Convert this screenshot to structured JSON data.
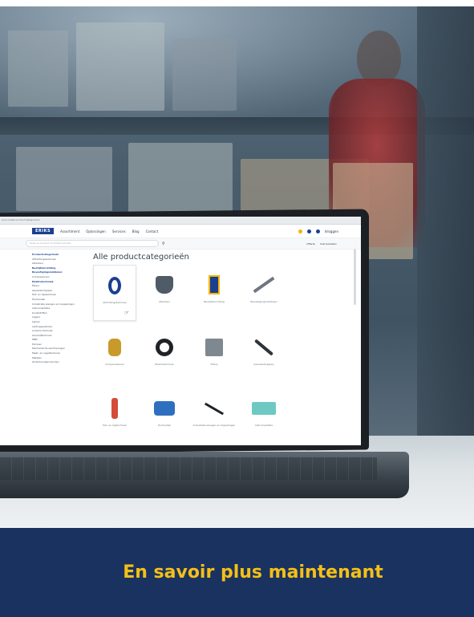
{
  "browser": {
    "url": "erics.nl/alle-productcategorieen"
  },
  "nav": {
    "logo": "ERIKS",
    "items": [
      "Assortiment",
      "Oplossingen",
      "Services",
      "Blog",
      "Contact"
    ],
    "login": "Inloggen"
  },
  "search": {
    "placeholder": "Zoek op product of artikelnummer",
    "links": [
      "Offerte",
      "Snel bestellen"
    ]
  },
  "sidebar": {
    "items": [
      "Productcategorieën",
      "Afdichtingstechniek",
      "Afsluiters",
      "Bedrijfsinrichting",
      "Bevestigingsmiddelen",
      "Compressoren",
      "Elektrotechniek",
      "Filters",
      "Gereedschappen",
      "Hef- en hijstechniek",
      "Hydrauliek",
      "Industriële slangen en koppelingen",
      "Instrumentatie",
      "Kunststoffen",
      "Lagers",
      "Lijmen",
      "Leidingsystemen",
      "Lineaire techniek",
      "Aandrijftechniek",
      "PBM",
      "Pompen",
      "Mechanische aandrijvingen",
      "Meet- en regeltechniek",
      "Metalen",
      "Onderhoudsproducten"
    ]
  },
  "main": {
    "title": "Alle productcategorieën",
    "categories": [
      "Afdichtingstechniek",
      "Afsluiters",
      "Bedrijfsinrichting",
      "Bevestigingsmiddelen",
      "Compensatoren",
      "Elektrotechniek",
      "Filters",
      "Gereedschappen",
      "Hef- en hijstechniek",
      "Hydrauliek",
      "Industriële slangen en koppelingen",
      "Instrumentatie"
    ]
  },
  "cta": {
    "label": "En savoir plus maintenant"
  },
  "colors": {
    "banner": "#1a3260",
    "cta_text": "#f4c017",
    "brand": "#1b3f8f"
  }
}
